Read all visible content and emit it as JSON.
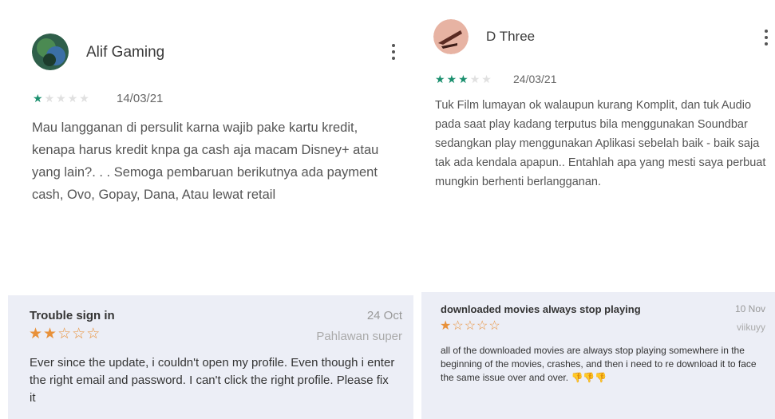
{
  "reviews": [
    {
      "author": "Alif Gaming",
      "rating": 1,
      "date": "14/03/21",
      "text": "Mau langganan di persulit karna wajib pake kartu kredit, kenapa harus kredit knpa ga cash aja macam Disney+ atau yang lain?. . . Semoga pembaruan berikutnya ada payment cash, Ovo, Gopay, Dana, Atau lewat retail"
    },
    {
      "author": "D Three",
      "rating": 3,
      "date": "24/03/21",
      "text": "Tuk Film lumayan ok walaupun kurang Komplit, dan tuk Audio pada saat play kadang terputus bila menggunakan Soundbar sedangkan play menggunakan Aplikasi sebelah baik - baik saja tak ada kendala apapun.. Entahlah apa yang mesti saya perbuat mungkin berhenti berlangganan."
    }
  ],
  "app_store_reviews": [
    {
      "title": "Trouble sign in",
      "rating": 2,
      "date": "24 Oct",
      "author": "Pahlawan super",
      "text": "Ever since the update, i couldn't open my profile. Even though i enter the right email and password. I can't click the right profile. Please fix it"
    },
    {
      "title": "downloaded movies always stop playing",
      "rating": 1,
      "date": "10 Nov",
      "author": "viikuyy",
      "text": "all of the downloaded movies are always stop playing somewhere in the beginning of the movies, crashes, and then i need to re download it to face the same issue over and over.",
      "emoji": "👎👎👎"
    }
  ],
  "colors": {
    "play_star": "#1a8f6e",
    "play_star_empty": "#e0e0e0",
    "appstore_star": "#e8913a",
    "panel_bg": "#eceef6"
  }
}
